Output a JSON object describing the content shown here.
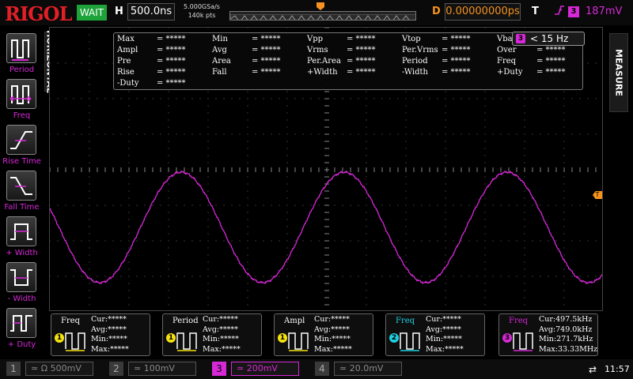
{
  "topbar": {
    "brand": "RIGOL",
    "run_status": "WAIT",
    "horizontal_label": "H",
    "timebase": "500.0ns",
    "sample_rate": "5.000GSa/s",
    "memory_depth": "140k pts",
    "delay_label": "D",
    "delay_value": "0.00000000ps",
    "trigger_label": "T",
    "trigger_slope": "rising",
    "trigger_source": "3",
    "trigger_level": "187mV"
  },
  "left_menu": {
    "section_title": "HORIZONTAL",
    "items": [
      {
        "label": "Period",
        "icon": "period-icon"
      },
      {
        "label": "Freq",
        "icon": "freq-icon"
      },
      {
        "label": "Rise Time",
        "icon": "rise-time-icon"
      },
      {
        "label": "Fall Time",
        "icon": "fall-time-icon"
      },
      {
        "label": "+ Width",
        "icon": "positive-width-icon"
      },
      {
        "label": "- Width",
        "icon": "negative-width-icon"
      },
      {
        "label": "+ Duty",
        "icon": "positive-duty-icon"
      }
    ]
  },
  "right_menu": {
    "section_title": "MEASURE"
  },
  "measure_panel": {
    "rows": [
      [
        {
          "name": "Max",
          "value": "= *****"
        },
        {
          "name": "Min",
          "value": "= *****"
        },
        {
          "name": "Vpp",
          "value": "= *****"
        },
        {
          "name": "Vtop",
          "value": "= *****"
        },
        {
          "name": "Vbas",
          "value": ""
        }
      ],
      [
        {
          "name": "Ampl",
          "value": "= *****"
        },
        {
          "name": "Avg",
          "value": "= *****"
        },
        {
          "name": "Vrms",
          "value": "= *****"
        },
        {
          "name": "Per.Vrms",
          "value": "= *****"
        },
        {
          "name": "Over",
          "value": "= *****"
        }
      ],
      [
        {
          "name": "Pre",
          "value": "= *****"
        },
        {
          "name": "Area",
          "value": "= *****"
        },
        {
          "name": "Per.Area",
          "value": "= *****"
        },
        {
          "name": "Period",
          "value": "= *****"
        },
        {
          "name": "Freq",
          "value": "= *****"
        }
      ],
      [
        {
          "name": "Rise",
          "value": "= *****"
        },
        {
          "name": "Fall",
          "value": "= *****"
        },
        {
          "name": "+Width",
          "value": "= *****"
        },
        {
          "name": "-Width",
          "value": "= *****"
        },
        {
          "name": "+Duty",
          "value": "= *****"
        }
      ],
      [
        {
          "name": "-Duty",
          "value": "= *****"
        }
      ]
    ]
  },
  "freq_warning": {
    "channel": "3",
    "text": "< 15 Hz"
  },
  "trigger_marker": "T",
  "results": [
    {
      "name": "Freq",
      "channel": "1",
      "color": "#f5e20f",
      "lines": [
        "Cur:*****",
        "Avg:*****",
        "Min:*****",
        "Max:*****"
      ]
    },
    {
      "name": "Period",
      "channel": "1",
      "color": "#f5e20f",
      "lines": [
        "Cur:*****",
        "Avg:*****",
        "Min:*****",
        "Max:*****"
      ]
    },
    {
      "name": "Ampl",
      "channel": "1",
      "color": "#f5e20f",
      "lines": [
        "Cur:*****",
        "Avg:*****",
        "Min:*****",
        "Max:*****"
      ]
    },
    {
      "name": "Freq",
      "channel": "2",
      "color": "#1fd0e0",
      "lines": [
        "Cur:*****",
        "Avg:*****",
        "Min:*****",
        "Max:*****"
      ]
    },
    {
      "name": "Freq",
      "channel": "3",
      "color": "#d628d6",
      "lines": [
        "Cur:497.5kHz",
        "Avg:749.0kHz",
        "Min:271.7kHz",
        "Max:33.33MHz"
      ]
    }
  ],
  "channels": [
    {
      "num": "1",
      "coupling": "≃ Ω",
      "scale": "500mV",
      "active": false
    },
    {
      "num": "2",
      "coupling": "≃",
      "scale": "100mV",
      "active": false
    },
    {
      "num": "3",
      "coupling": "≃",
      "scale": "200mV",
      "active": true
    },
    {
      "num": "4",
      "coupling": "≃",
      "scale": "20.0mV",
      "active": false
    }
  ],
  "clock": "11:57",
  "colors": {
    "ch1": "#f5e20f",
    "ch2": "#1fd0e0",
    "ch3": "#d628d6",
    "trigger": "#f7931e",
    "brand": "#e21f26",
    "wait": "#1ea33a"
  },
  "waveform": {
    "channel": "3",
    "shape": "sine",
    "cycles_shown": 3.4
  }
}
